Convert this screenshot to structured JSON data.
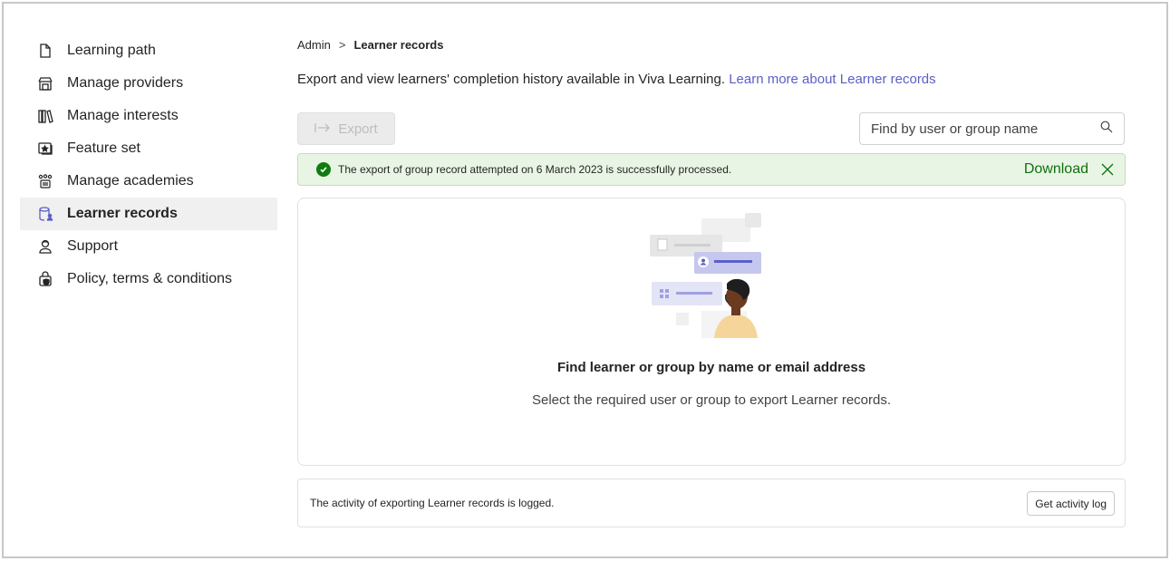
{
  "sidebar": {
    "items": [
      {
        "label": "Learning path",
        "icon": "document-icon",
        "active": false
      },
      {
        "label": "Manage providers",
        "icon": "building-shop-icon",
        "active": false
      },
      {
        "label": "Manage interests",
        "icon": "library-icon",
        "active": false
      },
      {
        "label": "Feature set",
        "icon": "slide-star-icon",
        "active": false
      },
      {
        "label": "Manage academies",
        "icon": "people-community-icon",
        "active": false
      },
      {
        "label": "Learner records",
        "icon": "database-person-icon",
        "active": true
      },
      {
        "label": "Support",
        "icon": "person-support-icon",
        "active": false
      },
      {
        "label": "Policy, terms & conditions",
        "icon": "lock-shield-icon",
        "active": false
      }
    ]
  },
  "breadcrumb": {
    "root": "Admin",
    "separator": ">",
    "current": "Learner records"
  },
  "description": {
    "text": "Export and view learners' completion history available in Viva Learning.",
    "link": "Learn more about Learner records"
  },
  "toolbar": {
    "export_label": "Export",
    "export_icon": "arrow-export-icon",
    "search_placeholder": "Find by user or group name",
    "search_icon": "search-icon"
  },
  "notification": {
    "message": "The export of group record attempted on 6 March 2023 is successfully processed.",
    "action": "Download",
    "status_color": "#107c10"
  },
  "empty_state": {
    "title": "Find learner or group by name or email address",
    "subtitle": "Select the required user or group to export Learner records."
  },
  "activity_log": {
    "message": "The activity of exporting Learner records is logged.",
    "button": "Get activity log"
  },
  "colors": {
    "accent": "#5b5fc7",
    "success_bg": "#e9f5e4",
    "success_text": "#0e700e"
  }
}
